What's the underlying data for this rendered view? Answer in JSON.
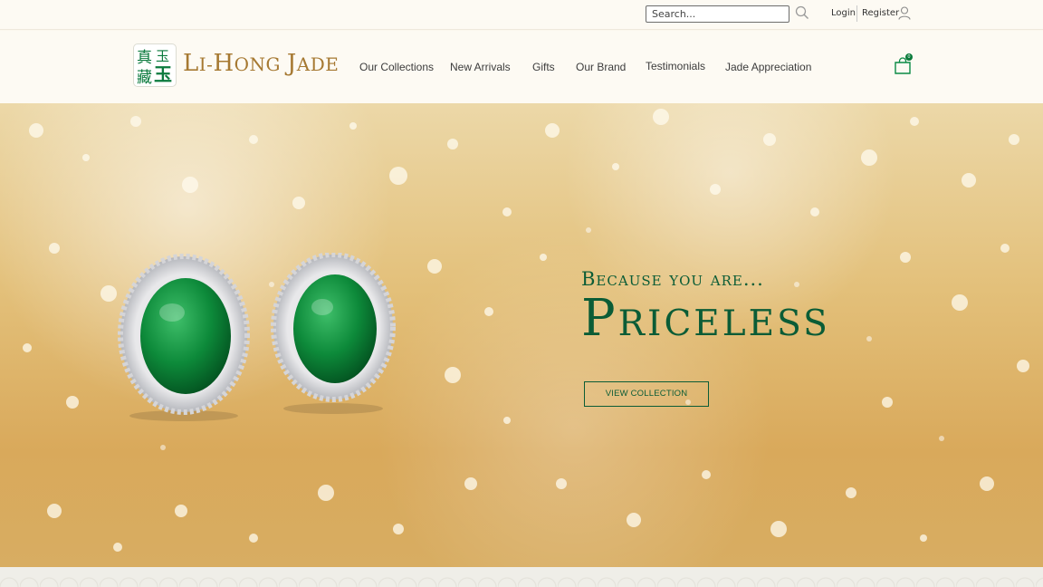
{
  "topbar": {
    "search_placeholder": "Search...",
    "login_label": "Login",
    "register_label": "Register"
  },
  "header": {
    "logo": {
      "text_initial_1": "L",
      "text_rest_1": "I-",
      "text_initial_2": "H",
      "text_rest_2": "ONG ",
      "text_initial_3": "J",
      "text_rest_3": "ADE",
      "emblem_chars": [
        "真",
        "玉",
        "藏",
        "玉"
      ]
    },
    "nav": [
      {
        "label": "Our Collections"
      },
      {
        "label": "New Arrivals"
      },
      {
        "label": "Gifts"
      },
      {
        "label": "Our Brand"
      },
      {
        "label": "Testimonials"
      },
      {
        "label": "Jade Appreciation"
      }
    ],
    "cart_count": "0"
  },
  "hero": {
    "tagline_small": "Because you are...",
    "tagline_big": "Priceless",
    "button_label": "VIEW COLLECTION"
  },
  "colors": {
    "brand_green": "#0b5c36",
    "brand_gold": "#a67932",
    "background": "#fdfaf3"
  },
  "icons": [
    "search-icon",
    "user-icon",
    "shopping-bag-icon"
  ]
}
